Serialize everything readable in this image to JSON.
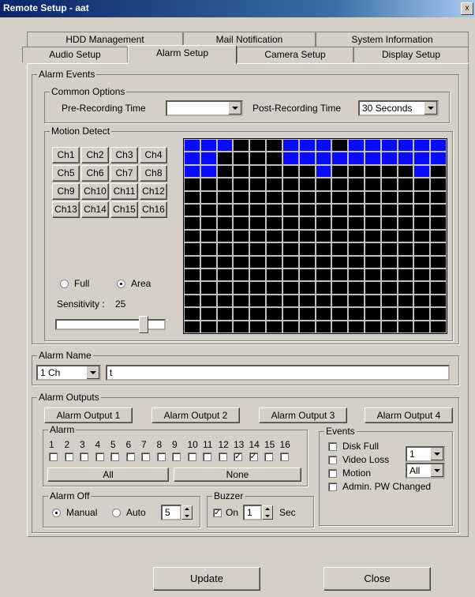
{
  "window": {
    "title": "Remote Setup - aat",
    "close_glyph": "x"
  },
  "tabs": {
    "row1": [
      "HDD Management",
      "Mail Notification",
      "System Information"
    ],
    "row2": [
      "Audio Setup",
      "Alarm Setup",
      "Camera Setup",
      "Display Setup"
    ],
    "active": "Alarm Setup"
  },
  "alarm_events": {
    "legend": "Alarm Events",
    "common_options": {
      "legend": "Common Options",
      "pre_recording_label": "Pre-Recording Time",
      "pre_recording_value": "",
      "post_recording_label": "Post-Recording Time",
      "post_recording_value": "30 Seconds"
    },
    "motion_detect": {
      "legend": "Motion Detect",
      "channels": [
        "Ch1",
        "Ch2",
        "Ch3",
        "Ch4",
        "Ch5",
        "Ch6",
        "Ch7",
        "Ch8",
        "Ch9",
        "Ch10",
        "Ch11",
        "Ch12",
        "Ch13",
        "Ch14",
        "Ch15",
        "Ch16"
      ],
      "mode_full": "Full",
      "mode_area": "Area",
      "selected_mode": "Area",
      "sensitivity_label": "Sensitivity :",
      "sensitivity_value": "25",
      "grid_rows": 15,
      "grid_cols": 16,
      "grid_active": [
        "1110001110111111",
        "1100001111111111",
        "1100000010000010"
      ],
      "colors": {
        "active": "#0a0aff",
        "inactive": "#000000",
        "line": "#c0c0c0"
      }
    }
  },
  "alarm_name": {
    "legend": "Alarm Name",
    "channel_value": "1 Ch",
    "name_value": "t"
  },
  "alarm_outputs": {
    "legend": "Alarm Outputs",
    "outputs": [
      "Alarm Output 1",
      "Alarm Output 2",
      "Alarm Output 3",
      "Alarm Output 4"
    ],
    "alarm": {
      "legend": "Alarm",
      "numbers": [
        "1",
        "2",
        "3",
        "4",
        "5",
        "6",
        "7",
        "8",
        "9",
        "10",
        "11",
        "12",
        "13",
        "14",
        "15",
        "16"
      ],
      "checked": [
        13,
        14
      ],
      "all_label": "All",
      "none_label": "None"
    },
    "events": {
      "legend": "Events",
      "items": [
        "Disk Full",
        "Video Loss",
        "Motion",
        "Admin. PW Changed"
      ],
      "combo1_value": "1",
      "combo2_value": "All"
    },
    "alarm_off": {
      "legend": "Alarm Off",
      "manual": "Manual",
      "auto": "Auto",
      "selected": "Manual",
      "value": "5"
    },
    "buzzer": {
      "legend": "Buzzer",
      "on_label": "On",
      "on_checked": true,
      "value": "1",
      "unit": "Sec"
    }
  },
  "footer": {
    "update_label": "Update",
    "close_label": "Close"
  }
}
